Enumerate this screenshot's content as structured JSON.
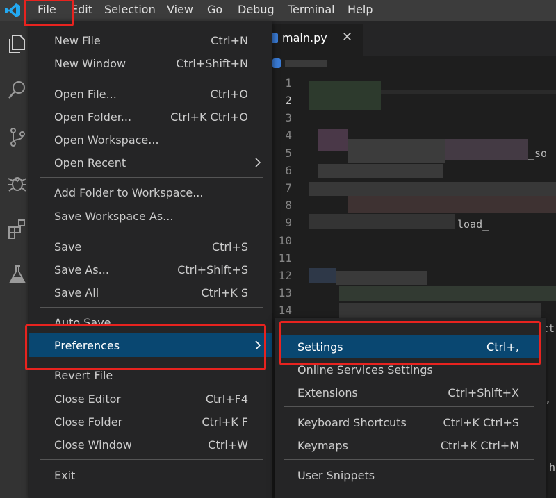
{
  "menubar": {
    "items": [
      "File",
      "Edit",
      "Selection",
      "View",
      "Go",
      "Debug",
      "Terminal",
      "Help"
    ]
  },
  "tab": {
    "label": "main.py",
    "close": "✕"
  },
  "editor": {
    "line_numbers": [
      "1",
      "2",
      "3",
      "4",
      "5",
      "6",
      "7",
      "8",
      "9",
      "10",
      "11",
      "12",
      "13",
      "14"
    ],
    "fragments": [
      "_so",
      "load_",
      "ct",
      ",",
      "h"
    ]
  },
  "file_menu": {
    "new_file": "New File",
    "new_file_key": "Ctrl+N",
    "new_window": "New Window",
    "new_window_key": "Ctrl+Shift+N",
    "open_file": "Open File...",
    "open_file_key": "Ctrl+O",
    "open_folder": "Open Folder...",
    "open_folder_key": "Ctrl+K Ctrl+O",
    "open_workspace": "Open Workspace...",
    "open_recent": "Open Recent",
    "add_folder": "Add Folder to Workspace...",
    "save_workspace_as": "Save Workspace As...",
    "save": "Save",
    "save_key": "Ctrl+S",
    "save_as": "Save As...",
    "save_as_key": "Ctrl+Shift+S",
    "save_all": "Save All",
    "save_all_key": "Ctrl+K S",
    "auto_save": "Auto Save",
    "preferences": "Preferences",
    "revert_file": "Revert File",
    "close_editor": "Close Editor",
    "close_editor_key": "Ctrl+F4",
    "close_folder": "Close Folder",
    "close_folder_key": "Ctrl+K F",
    "close_window": "Close Window",
    "close_window_key": "Ctrl+W",
    "exit": "Exit"
  },
  "preferences_menu": {
    "settings": "Settings",
    "settings_key": "Ctrl+,",
    "online_services": "Online Services Settings",
    "extensions": "Extensions",
    "extensions_key": "Ctrl+Shift+X",
    "keyboard_shortcuts": "Keyboard Shortcuts",
    "keyboard_shortcuts_key": "Ctrl+K Ctrl+S",
    "keymaps": "Keymaps",
    "keymaps_key": "Ctrl+K Ctrl+M",
    "user_snippets": "User Snippets"
  },
  "colors": {
    "menubar_bg": "#3c3c3c",
    "menu_bg": "#252526",
    "highlight": "#094771",
    "annotation": "#e8231f",
    "accent": "#007acc"
  }
}
